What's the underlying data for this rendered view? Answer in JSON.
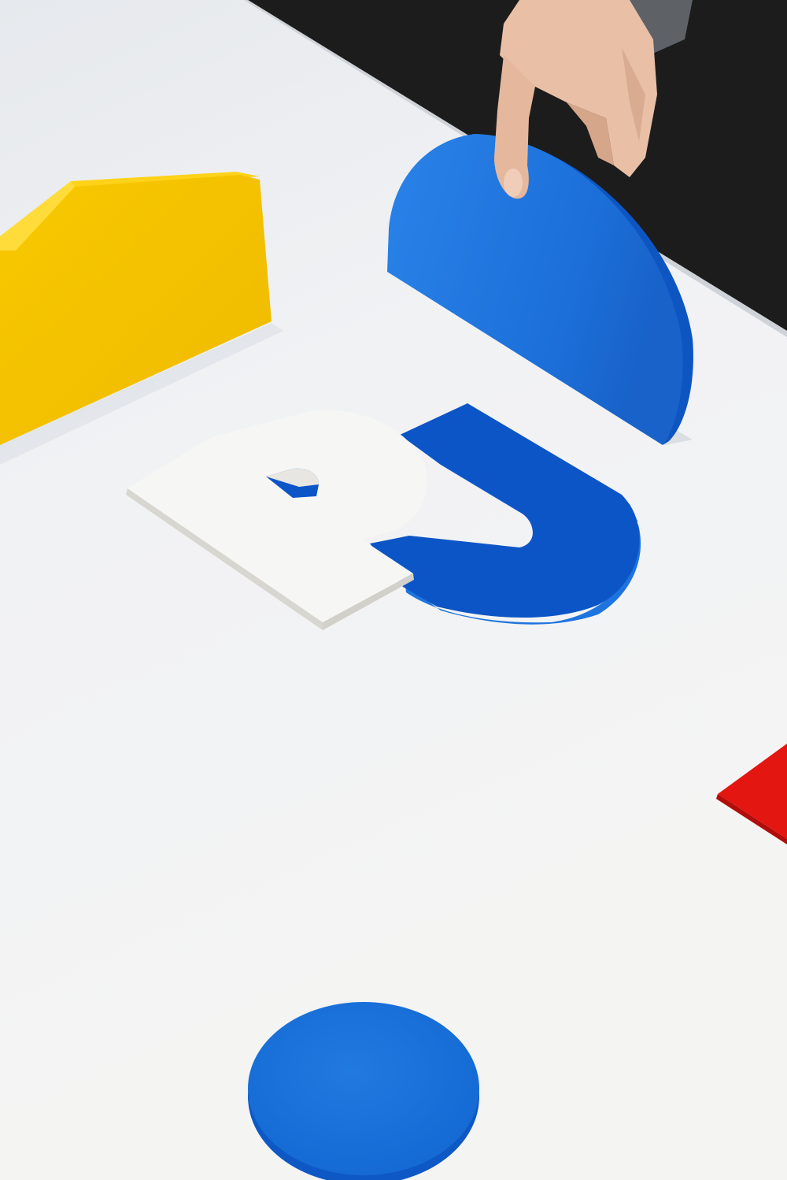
{
  "scene": {
    "colors": {
      "background_dark": "#1c1c1c",
      "table_white": "#f2f3f4",
      "table_shadow": "#d9dde2",
      "yellow_face": "#f7c600",
      "yellow_top": "#ffd21a",
      "yellow_shadow": "#e3b200",
      "blue_bright": "#1f78e0",
      "blue_deep": "#0c55c7",
      "blue_edge": "#0a46a8",
      "white_piece": "#f6f6f4",
      "white_piece_edge": "#d8d6d0",
      "red": "#e41612",
      "skin": "#e9c0a6",
      "skin_shadow": "#c99479",
      "sleeve": "#5e6166"
    },
    "objects": [
      "yellow-block",
      "blue-half-circle",
      "white-letter-p",
      "blue-letter-u",
      "red-piece",
      "blue-disc",
      "hand"
    ]
  }
}
